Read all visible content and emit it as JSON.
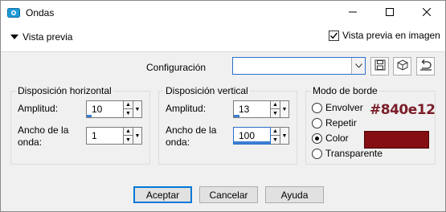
{
  "window": {
    "title": "Ondas"
  },
  "toolbar": {
    "preview_toggle": "Vista previa",
    "preview_in_image": "Vista previa en imagen",
    "preview_in_image_checked": true
  },
  "config": {
    "label": "Configuración",
    "value": ""
  },
  "horizontal": {
    "title": "Disposición horizontal",
    "amplitude_label": "Amplitud:",
    "amplitude_value": "10",
    "wavelength_label_line1": "Ancho de la",
    "wavelength_label_line2": "onda:",
    "wavelength_value": "1"
  },
  "vertical": {
    "title": "Disposición vertical",
    "amplitude_label": "Amplitud:",
    "amplitude_value": "13",
    "wavelength_label_line1": "Ancho de la",
    "wavelength_label_line2": "onda:",
    "wavelength_value": "100"
  },
  "edge": {
    "title": "Modo de borde",
    "options": [
      "Envolver",
      "Repetir",
      "Color",
      "Transparente"
    ],
    "selected": "Color",
    "color_hex": "#840e12",
    "color": "#840e12"
  },
  "buttons": {
    "ok": "Aceptar",
    "cancel": "Cancelar",
    "help": "Ayuda"
  },
  "icons": {
    "app": "app-icon",
    "minimize": "minimize-icon",
    "maximize": "maximize-icon",
    "close": "close-icon",
    "save": "save-icon",
    "cube": "cube-icon",
    "reset": "reset-icon"
  }
}
